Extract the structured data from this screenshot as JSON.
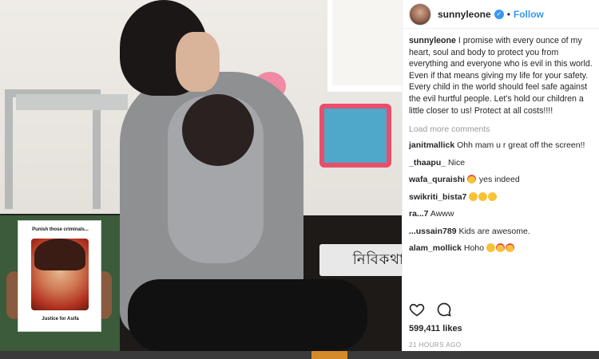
{
  "post": {
    "username": "sunnyleone",
    "follow_label": "Follow",
    "caption_username": "sunnyleone",
    "caption_text": "I promise with every ounce of my heart, soul and body to protect you from everything and everyone who is evil in this world. Even if that means giving my life for your safety. Every child in the world should feel safe against the evil hurtful people. Let's hold our children a little closer to us! Protect at all costs!!!!",
    "load_more": "Load more comments",
    "comments": [
      {
        "user": "janitmallick",
        "text": "Ohh mam u r great off the screen!!"
      },
      {
        "user": "_thaapu_",
        "text": "Nice"
      },
      {
        "user": "wafa_quraishi",
        "text": "yes indeed",
        "emoji": [
          "heart-eyes"
        ]
      },
      {
        "user": "swikriti_bista7",
        "text": "",
        "emoji": [
          "crying",
          "crying",
          "crying"
        ]
      },
      {
        "user": "ra...7",
        "text": "Awww"
      },
      {
        "user": "...ussain789",
        "text": "Kids are awesome."
      },
      {
        "user": "alam_mollick",
        "text": "Hoho",
        "emoji": [
          "sunglasses",
          "heart-eyes",
          "heart-eyes"
        ]
      }
    ],
    "likes": "599,411 likes",
    "time": "21 HOURS AGO"
  },
  "inset": {
    "poster_top": "Punish those criminals...",
    "poster_bottom": "Justice for Asifa"
  },
  "watermark": "নিবিকথা",
  "colors": {
    "follow": "#3897f0",
    "verified": "#3897f0",
    "text": "#262626",
    "muted": "#999999"
  }
}
